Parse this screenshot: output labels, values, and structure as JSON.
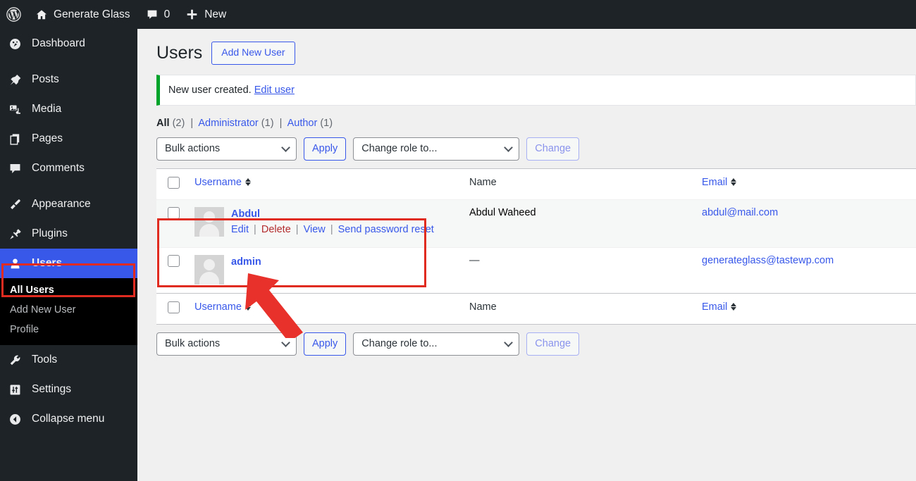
{
  "adminbar": {
    "logo_icon": "wordpress-logo-icon",
    "site_icon": "home-icon",
    "site_name": "Generate Glass",
    "comments_icon": "comment-bubble-icon",
    "comments_count": "0",
    "new_icon": "plus-icon",
    "new_label": "New"
  },
  "sidebar": {
    "items": [
      {
        "label": "Dashboard",
        "icon": "dashboard-icon"
      },
      {
        "label": "Posts",
        "icon": "pin-icon"
      },
      {
        "label": "Media",
        "icon": "media-icon"
      },
      {
        "label": "Pages",
        "icon": "pages-icon"
      },
      {
        "label": "Comments",
        "icon": "comment-icon"
      },
      {
        "label": "Appearance",
        "icon": "paintbrush-icon"
      },
      {
        "label": "Plugins",
        "icon": "plug-icon"
      },
      {
        "label": "Users",
        "icon": "user-icon"
      },
      {
        "label": "Tools",
        "icon": "wrench-icon"
      },
      {
        "label": "Settings",
        "icon": "settings-icon"
      },
      {
        "label": "Collapse menu",
        "icon": "collapse-arrow-icon"
      }
    ],
    "submenu": [
      {
        "label": "All Users",
        "current": true
      },
      {
        "label": "Add New User",
        "current": false
      },
      {
        "label": "Profile",
        "current": false
      }
    ],
    "active_item": "Users",
    "active_color": "#3858e9"
  },
  "page": {
    "title": "Users",
    "add_new_label": "Add New User"
  },
  "notice": {
    "text": "New user created.",
    "link_label": "Edit user",
    "accent_color": "#00a32a"
  },
  "filters": {
    "all_label": "All",
    "all_count": "(2)",
    "administrator_label": "Administrator",
    "administrator_count": "(1)",
    "author_label": "Author",
    "author_count": "(1)",
    "separator": "|"
  },
  "tablenav": {
    "bulk_actions_label": "Bulk actions",
    "apply_label": "Apply",
    "change_role_label": "Change role to...",
    "change_label": "Change"
  },
  "table": {
    "columns": {
      "username": "Username",
      "name": "Name",
      "email": "Email"
    },
    "rows": [
      {
        "username": "Abdul",
        "name": "Abdul Waheed",
        "email": "abdul@mail.com",
        "actions": {
          "edit": "Edit",
          "delete": "Delete",
          "view": "View",
          "send_password_reset": "Send password reset"
        }
      },
      {
        "username": "admin",
        "name": "—",
        "email": "generateglass@tastewp.com",
        "actions": null
      }
    ]
  },
  "annotations": {
    "highlight_color": "#e02b20",
    "box_all_users": "All Users",
    "box_user_row": "Abdul",
    "arrow_points_to": "Edit"
  }
}
